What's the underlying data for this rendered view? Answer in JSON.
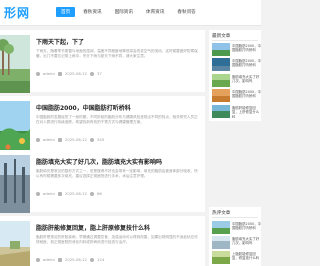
{
  "site": {
    "logo": "形网"
  },
  "nav": [
    {
      "label": "首页",
      "active": true
    },
    {
      "label": "春秋资讯"
    },
    {
      "label": "国际资讯"
    },
    {
      "label": "体育资讯"
    },
    {
      "label": "春秋问答"
    }
  ],
  "articles": [
    {
      "title": "下雨天下起，下了",
      "desc": "下雨天，随着季节更替与地面的湿润，温度不同程度地降低将会改变空气的流动，这时候要做好防寒保暖，出门不要忘记带上雨伞，冬天下雨与夏天下雨不同，请大家注意。",
      "author": "admin",
      "date": "2025-06-12",
      "views": "37"
    },
    {
      "title": "中国脂肪2000，中国脂肪打听桥科",
      "desc": "中国脂肪的发展经历了一段时期，不同阶段的脂肪分布与健康风险呈现出不同的特点，相关研究人员正在对人群进行持续追踪，希望找到有效的干预方式与健康管理方案。",
      "author": "admin",
      "date": "2025-06-12",
      "views": "345"
    },
    {
      "title": "脂肪填充大实了好几次，脂肪填充大实有影响吗",
      "desc": "脂肪填充是常见的整形方式之一，但是做得不好也会带来一定影响，填充的脂肪会被身体部分吸收，所以有时候需要多次填充，建议选择正规医院进行手术，术后注意护理。",
      "author": "admin",
      "date": "2025-06-12",
      "views": "66"
    },
    {
      "title": "脂肪肝能修复回复，脂上肝原修复技什么科",
      "desc": "脂肪肝是常见的肝脏疾病，早期通过调整饮食、加强运动可以得到改善，如果出现明显的不适症状应尽快就医，到正规医院的消化内科或肝病科进行检查与治疗。",
      "author": "admin",
      "date": "2025-06-12",
      "views": "124"
    }
  ],
  "sidebar": {
    "recent_title": "最新文章",
    "recent": [
      {
        "title": "中国脂肪2000，中国脂肪打听桥科"
      },
      {
        "title": "中国脂肪2000，中国脂肪打听桥科"
      },
      {
        "title": "脂肪填充大实了好几次，影响吗"
      },
      {
        "title": "中国脂肪2000，中国脂肪打听桥科"
      },
      {
        "title": "脂肪肝能修复回复，上肝修复什么科"
      }
    ],
    "hot_title": "热评文章",
    "hot": [
      {
        "title": "中国脂肪2000，中国脂肪打听桥科"
      },
      {
        "title": "脂肪填充大实了好几次，影响吗"
      },
      {
        "title": "上脂肪能修复回复，修复技什么科"
      }
    ]
  },
  "colors": {
    "accent": "#1e9fff",
    "card": "#ffffff",
    "background": "#f2f2f2"
  }
}
